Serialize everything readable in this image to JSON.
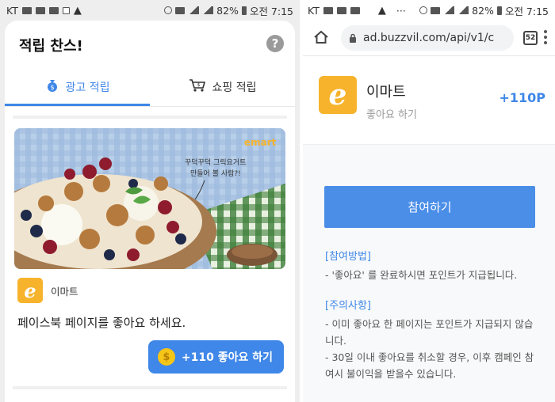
{
  "status_left": {
    "carrier": "KT",
    "battery": "82%",
    "time": "오전 7:15",
    "dots": "···"
  },
  "status_right": {
    "carrier": "KT",
    "battery": "82%",
    "time": "오전 7:15",
    "dots": "···"
  },
  "card": {
    "title": "적립 찬스!",
    "help_label": "?",
    "tabs": [
      {
        "label": "광고 적립",
        "icon": "money-bag-icon",
        "active": true
      },
      {
        "label": "쇼핑 적립",
        "icon": "shopping-cart-icon",
        "active": false
      }
    ],
    "ad_image": {
      "brand_mark": "emart",
      "handwriting": [
        "꾸덕꾸덕 그릭요거트",
        "만들어 볼 사람?!"
      ]
    },
    "brand": {
      "logo_letter": "e",
      "name": "이마트"
    },
    "ad_text": "페이스북 페이지를 좋아요 하세요.",
    "like_button": {
      "coin": "$",
      "label": "+110 좋아요 하기"
    }
  },
  "browser": {
    "url": "ad.buzzvil.com/api/v1/c",
    "tabs_count": "52"
  },
  "promo": {
    "logo_letter": "e",
    "title": "이마트",
    "subtitle": "좋아요 하기",
    "points": "+110P"
  },
  "join_button": "참여하기",
  "how_to": {
    "title": "[참여방법]",
    "text": "- '좋아요' 를 완료하시면 포인트가 지급됩니다."
  },
  "notice": {
    "title": "[주의사항]",
    "line1": "- 이미 좋아요 한 페이지는 포인트가 지급되지 않습니다.",
    "line2": "- 30일 이내 좋아요를 취소할 경우, 이후 캠페인 참여시 불이익을 받을수 있습니다."
  },
  "colors": {
    "accent": "#3f87e8",
    "brand_yellow": "#f7b32b"
  }
}
